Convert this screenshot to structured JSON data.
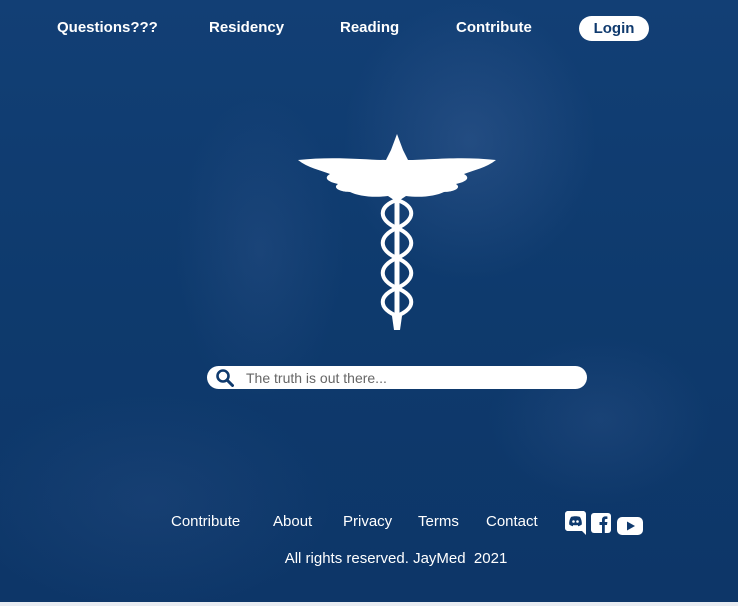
{
  "nav": {
    "items": [
      {
        "label": "Questions???"
      },
      {
        "label": "Residency"
      },
      {
        "label": "Reading"
      },
      {
        "label": "Contribute"
      }
    ],
    "login_label": "Login"
  },
  "search": {
    "placeholder": "The truth is out there..."
  },
  "footer": {
    "links": [
      {
        "label": "Contribute"
      },
      {
        "label": "About"
      },
      {
        "label": "Privacy"
      },
      {
        "label": "Terms"
      },
      {
        "label": "Contact"
      }
    ],
    "social": [
      {
        "icon": "discord-icon"
      },
      {
        "icon": "facebook-icon"
      },
      {
        "icon": "youtube-icon"
      }
    ],
    "copyright": "All rights reserved. JayMed  2021"
  },
  "colors": {
    "background": "#0f3a6e",
    "accent": "#ffffff"
  }
}
